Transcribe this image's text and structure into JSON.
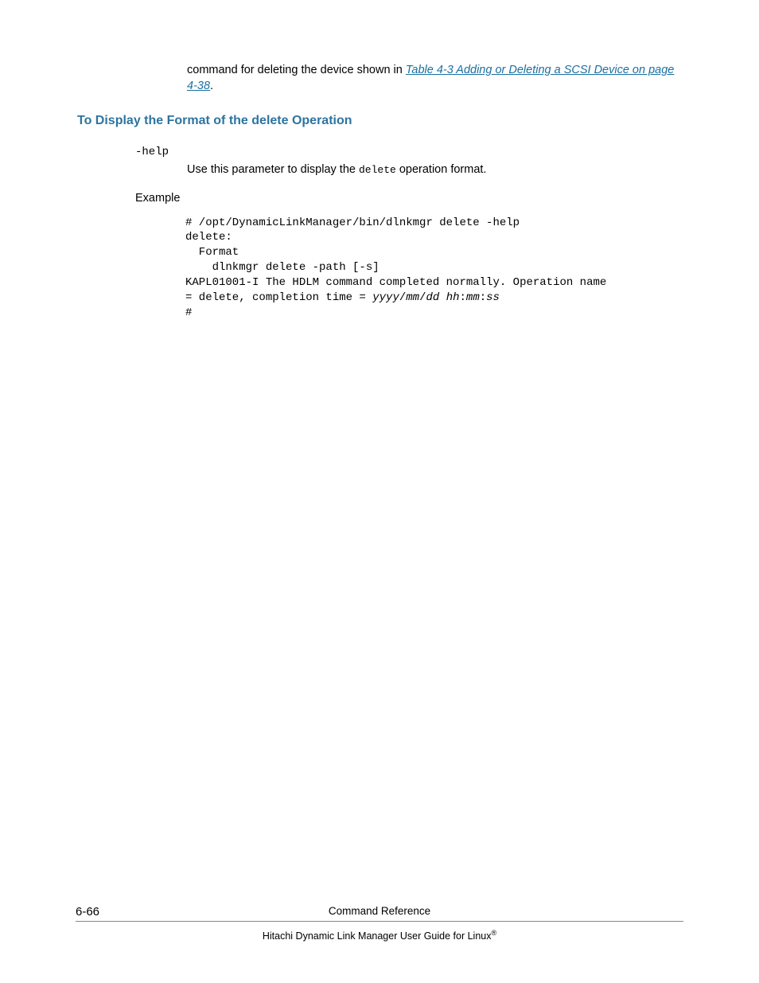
{
  "intro": {
    "before_link": "command for deleting the device shown in ",
    "link_text": "Table 4-3 Adding or Deleting a SCSI Device on page 4-38",
    "after_link": "."
  },
  "section": {
    "heading": "To Display the Format of the delete Operation"
  },
  "param": {
    "name": "-help",
    "desc_before": "Use this parameter to display the ",
    "desc_code": "delete",
    "desc_after": " operation format."
  },
  "example": {
    "label": "Example",
    "code_line1": "# /opt/DynamicLinkManager/bin/dlnkmgr delete -help",
    "code_line2": "delete:",
    "code_line3": "  Format",
    "code_line4": "    dlnkmgr delete -path [-s]",
    "code_line5": "KAPL01001-I The HDLM command completed normally. Operation name ",
    "code_line6_before": "= delete, completion time = ",
    "code_line6_italic": "yyyy",
    "code_line6_slash1": "/",
    "code_line6_mm": "mm",
    "code_line6_slash2": "/",
    "code_line6_dd": "dd",
    "code_line6_space": " ",
    "code_line6_hh": "hh",
    "code_line6_colon1": ":",
    "code_line6_mm2": "mm",
    "code_line6_colon2": ":",
    "code_line6_ss": "ss",
    "code_line7": "#"
  },
  "footer": {
    "page_number": "6-66",
    "section_title": "Command Reference",
    "guide_title": "Hitachi Dynamic Link Manager User Guide for Linux",
    "registered": "®"
  }
}
